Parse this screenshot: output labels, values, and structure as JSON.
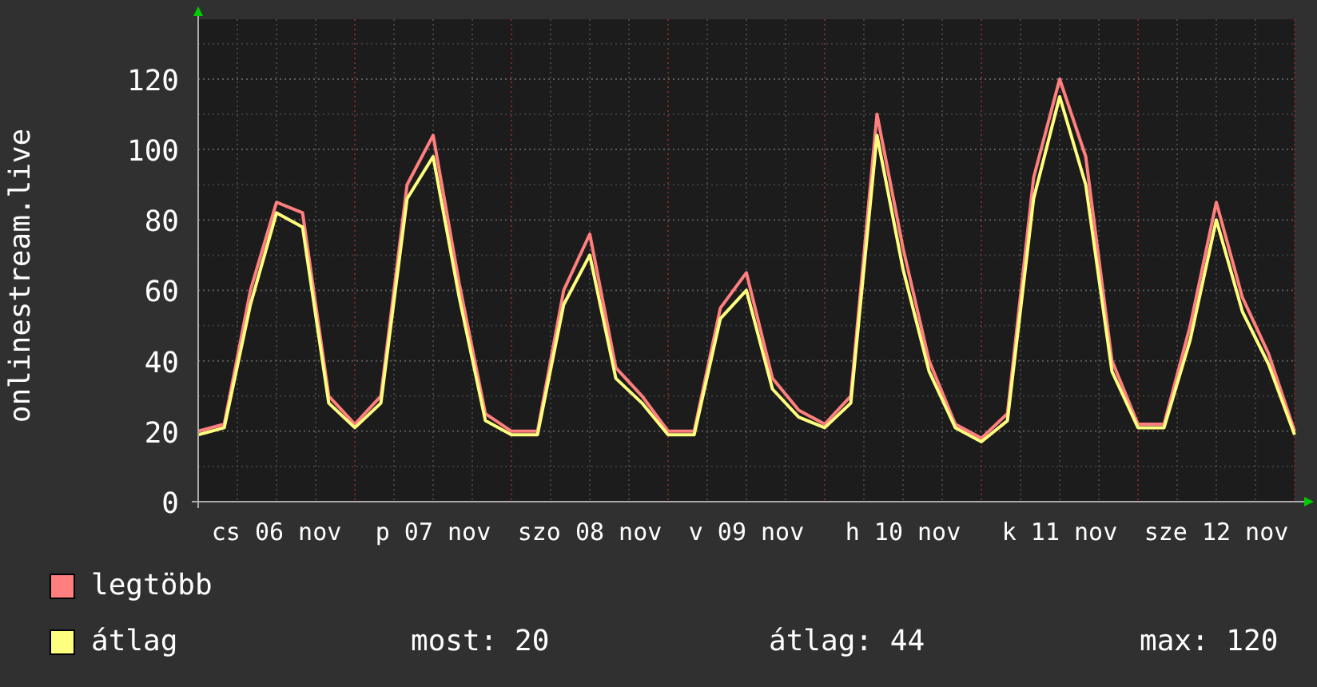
{
  "chart_data": {
    "type": "line",
    "ylabel": "onlinestream.live",
    "categories": [
      null,
      null,
      null,
      "cs 06 nov",
      null,
      null,
      null,
      null,
      null,
      "p 07 nov",
      null,
      null,
      null,
      null,
      null,
      "szo 08 nov",
      null,
      null,
      null,
      null,
      null,
      "v 09 nov",
      null,
      null,
      null,
      null,
      null,
      "h 10 nov",
      null,
      null,
      null,
      null,
      null,
      "k 11 nov",
      null,
      null,
      null,
      null,
      null,
      "sze 12 nov",
      null,
      null,
      null
    ],
    "ylim": [
      0,
      137
    ],
    "grid": true,
    "yticks": [
      0,
      20,
      40,
      60,
      80,
      100,
      120
    ],
    "series": [
      {
        "name": "legtöbb",
        "color": "#ff7f7f",
        "values": [
          20,
          22,
          60,
          85,
          82,
          30,
          22,
          30,
          90,
          104,
          62,
          25,
          20,
          20,
          60,
          76,
          38,
          30,
          20,
          20,
          55,
          65,
          35,
          26,
          22,
          30,
          110,
          72,
          40,
          22,
          18,
          25,
          92,
          120,
          98,
          40,
          22,
          22,
          50,
          85,
          58,
          42,
          20
        ]
      },
      {
        "name": "átlag",
        "color": "#ffff7f",
        "values": [
          19,
          21,
          56,
          82,
          78,
          28,
          21,
          28,
          86,
          98,
          58,
          23,
          19,
          19,
          56,
          70,
          35,
          28,
          19,
          19,
          52,
          60,
          32,
          24,
          21,
          28,
          104,
          66,
          37,
          21,
          17,
          23,
          86,
          115,
          90,
          37,
          21,
          21,
          46,
          80,
          54,
          39,
          19
        ]
      }
    ]
  },
  "stats": [
    "most: 20",
    "átlag: 44",
    "max: 120"
  ]
}
